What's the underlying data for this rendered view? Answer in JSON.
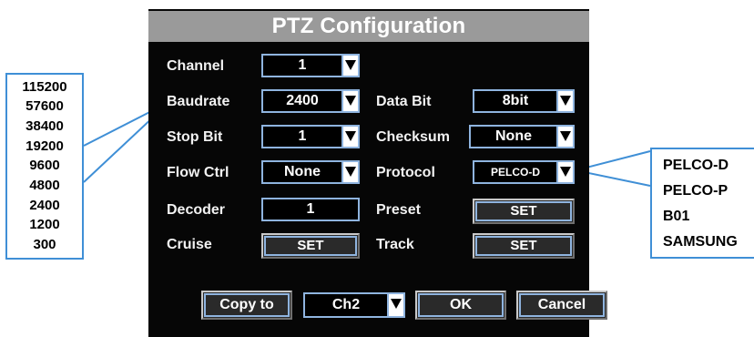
{
  "dialog": {
    "title": "PTZ Configuration",
    "labels": {
      "channel": "Channel",
      "baudrate": "Baudrate",
      "data_bit": "Data Bit",
      "stop_bit": "Stop Bit",
      "checksum": "Checksum",
      "flow_ctrl": "Flow Ctrl",
      "protocol": "Protocol",
      "decoder": "Decoder",
      "preset": "Preset",
      "cruise": "Cruise",
      "track": "Track"
    },
    "values": {
      "channel": "1",
      "baudrate": "2400",
      "data_bit": "8bit",
      "stop_bit": "1",
      "checksum": "None",
      "flow_ctrl": "None",
      "protocol": "PELCO-D",
      "decoder": "1",
      "copy_target": "Ch2"
    },
    "buttons": {
      "preset_set": "SET",
      "cruise_set": "SET",
      "track_set": "SET",
      "copy_to": "Copy to",
      "ok": "OK",
      "cancel": "Cancel"
    }
  },
  "baudrate_options": [
    "115200",
    "57600",
    "38400",
    "19200",
    "9600",
    "4800",
    "2400",
    "1200",
    "300"
  ],
  "protocol_options": [
    "PELCO-D",
    "PELCO-P",
    "B01",
    "SAMSUNG"
  ],
  "colors": {
    "dialog_bg": "#060606",
    "title_bar": "#9a9a9a",
    "field_border": "#8fb4df",
    "callout": "#3f8fd6"
  },
  "icons": {
    "dropdown": "down-triangle-icon"
  }
}
